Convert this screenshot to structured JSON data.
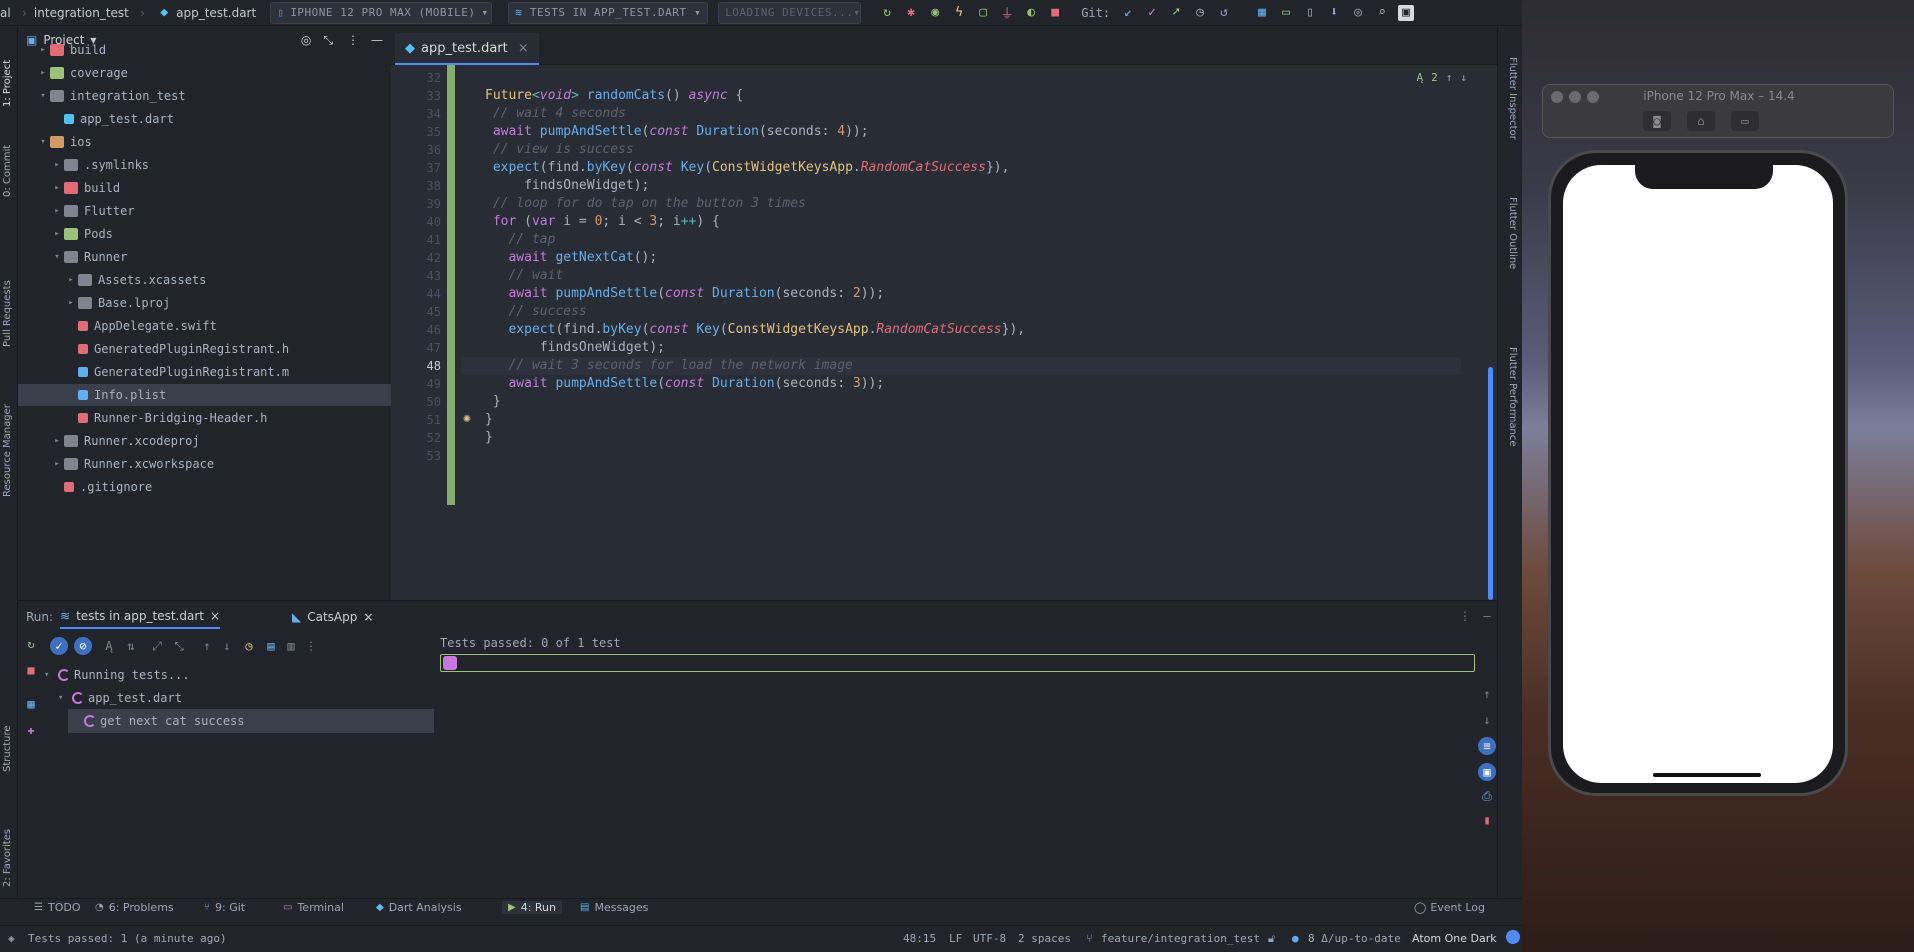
{
  "topbar": {
    "breadcrumb": [
      "al",
      "integration_test",
      "app_test.dart"
    ],
    "device_combo": "IPHONE 12 PRO MAX (MOBILE)",
    "config_combo": "TESTS IN APP_TEST.DART",
    "loading_combo": "LOADING DEVICES...",
    "git_label": "Git:"
  },
  "left_strip": {
    "project_tab": "1: Project",
    "commit_tab": "0: Commit",
    "pull_requests_tab": "Pull Requests",
    "resource_manager_tab": "Resource Manager",
    "structure_tab": "Structure",
    "favorites_tab": "2: Favorites"
  },
  "right_strip": {
    "inspector": "Flutter Inspector",
    "outline": "Flutter Outline",
    "performance": "Flutter Performance"
  },
  "project": {
    "title": "Project",
    "items": [
      {
        "label": "build",
        "indent": 1,
        "arrow": "▸",
        "icon": "folder-red"
      },
      {
        "label": "coverage",
        "indent": 1,
        "arrow": "▸",
        "icon": "folder-green"
      },
      {
        "label": "integration_test",
        "indent": 1,
        "arrow": "▾",
        "icon": "folder"
      },
      {
        "label": "app_test.dart",
        "indent": 2,
        "arrow": "",
        "icon": "dart"
      },
      {
        "label": "ios",
        "indent": 1,
        "arrow": "▾",
        "icon": "tools"
      },
      {
        "label": ".symlinks",
        "indent": 2,
        "arrow": "▸",
        "icon": "folder"
      },
      {
        "label": "build",
        "indent": 2,
        "arrow": "▸",
        "icon": "folder-red"
      },
      {
        "label": "Flutter",
        "indent": 2,
        "arrow": "▸",
        "icon": "folder"
      },
      {
        "label": "Pods",
        "indent": 2,
        "arrow": "▸",
        "icon": "folder-green"
      },
      {
        "label": "Runner",
        "indent": 2,
        "arrow": "▾",
        "icon": "folder"
      },
      {
        "label": "Assets.xcassets",
        "indent": 3,
        "arrow": "▸",
        "icon": "folder"
      },
      {
        "label": "Base.lproj",
        "indent": 3,
        "arrow": "▸",
        "icon": "folder"
      },
      {
        "label": "AppDelegate.swift",
        "indent": 3,
        "arrow": "",
        "icon": "swift"
      },
      {
        "label": "GeneratedPluginRegistrant.h",
        "indent": 3,
        "arrow": "",
        "icon": "h"
      },
      {
        "label": "GeneratedPluginRegistrant.m",
        "indent": 3,
        "arrow": "",
        "icon": "m"
      },
      {
        "label": "Info.plist",
        "indent": 3,
        "arrow": "",
        "icon": "plist",
        "selected": true
      },
      {
        "label": "Runner-Bridging-Header.h",
        "indent": 3,
        "arrow": "",
        "icon": "h"
      },
      {
        "label": "Runner.xcodeproj",
        "indent": 2,
        "arrow": "▸",
        "icon": "folder"
      },
      {
        "label": "Runner.xcworkspace",
        "indent": 2,
        "arrow": "▸",
        "icon": "folder"
      },
      {
        "label": ".gitignore",
        "indent": 2,
        "arrow": "",
        "icon": "git"
      }
    ]
  },
  "editor": {
    "tab_label": "app_test.dart",
    "inspection_count": "2",
    "current_line": 48,
    "lines": [
      {
        "n": 32,
        "t": [
          [
            "",
            ""
          ]
        ]
      },
      {
        "n": 33,
        "t": [
          [
            "ty",
            "Future"
          ],
          [
            "op",
            "<"
          ],
          [
            "kwi",
            "void"
          ],
          [
            "op",
            "> "
          ],
          [
            "fn",
            "randomCats"
          ],
          [
            "",
            "() "
          ],
          [
            "kwi",
            "async"
          ],
          [
            "",
            " {"
          ]
        ]
      },
      {
        "n": 34,
        "t": [
          [
            "",
            " "
          ],
          [
            "cm",
            "// wait 4 seconds"
          ]
        ]
      },
      {
        "n": 35,
        "t": [
          [
            "",
            " "
          ],
          [
            "kw",
            "await "
          ],
          [
            "fn",
            "pumpAndSettle"
          ],
          [
            "",
            "("
          ],
          [
            "kwi",
            "const "
          ],
          [
            "fn",
            "Duration"
          ],
          [
            "",
            "(seconds: "
          ],
          [
            "num",
            "4"
          ],
          [
            "",
            "));"
          ]
        ]
      },
      {
        "n": 36,
        "t": [
          [
            "",
            " "
          ],
          [
            "cm",
            "// view is success"
          ]
        ]
      },
      {
        "n": 37,
        "t": [
          [
            "",
            " "
          ],
          [
            "fn",
            "expect"
          ],
          [
            "",
            "("
          ],
          [
            "",
            "find."
          ],
          [
            "fn",
            "byKey"
          ],
          [
            "",
            "("
          ],
          [
            "kwi",
            "const "
          ],
          [
            "fn",
            "Key"
          ],
          [
            "",
            "("
          ],
          [
            "ty",
            "ConstWidgetKeysApp"
          ],
          [
            "",
            "."
          ],
          [
            "en",
            "RandomCatSuccess"
          ],
          [
            "",
            "}),"
          ]
        ]
      },
      {
        "n": 38,
        "t": [
          [
            "",
            "     findsOneWidget);"
          ]
        ]
      },
      {
        "n": 39,
        "t": [
          [
            "",
            " "
          ],
          [
            "cm",
            "// loop for do tap on the button 3 times"
          ]
        ]
      },
      {
        "n": 40,
        "t": [
          [
            "",
            " "
          ],
          [
            "kw",
            "for "
          ],
          [
            "",
            "("
          ],
          [
            "kw",
            "var"
          ],
          [
            "",
            " i = "
          ],
          [
            "num",
            "0"
          ],
          [
            "",
            "; i < "
          ],
          [
            "num",
            "3"
          ],
          [
            "",
            "; i"
          ],
          [
            "op",
            "++"
          ],
          [
            "",
            ") {"
          ]
        ]
      },
      {
        "n": 41,
        "t": [
          [
            "",
            "   "
          ],
          [
            "cm",
            "// tap"
          ]
        ]
      },
      {
        "n": 42,
        "t": [
          [
            "",
            "   "
          ],
          [
            "kw",
            "await "
          ],
          [
            "fn",
            "getNextCat"
          ],
          [
            "",
            "();"
          ]
        ]
      },
      {
        "n": 43,
        "t": [
          [
            "",
            "   "
          ],
          [
            "cm",
            "// wait"
          ]
        ]
      },
      {
        "n": 44,
        "t": [
          [
            "",
            "   "
          ],
          [
            "kw",
            "await "
          ],
          [
            "fn",
            "pumpAndSettle"
          ],
          [
            "",
            "("
          ],
          [
            "kwi",
            "const "
          ],
          [
            "fn",
            "Duration"
          ],
          [
            "",
            "(seconds: "
          ],
          [
            "num",
            "2"
          ],
          [
            "",
            "));"
          ]
        ]
      },
      {
        "n": 45,
        "t": [
          [
            "",
            "   "
          ],
          [
            "cm",
            "// success"
          ]
        ]
      },
      {
        "n": 46,
        "t": [
          [
            "",
            "   "
          ],
          [
            "fn",
            "expect"
          ],
          [
            "",
            "(find."
          ],
          [
            "fn",
            "byKey"
          ],
          [
            "",
            "("
          ],
          [
            "kwi",
            "const "
          ],
          [
            "fn",
            "Key"
          ],
          [
            "",
            "("
          ],
          [
            "ty",
            "ConstWidgetKeysApp"
          ],
          [
            "",
            "."
          ],
          [
            "en",
            "RandomCatSuccess"
          ],
          [
            "",
            "}),"
          ]
        ]
      },
      {
        "n": 47,
        "t": [
          [
            "",
            "       findsOneWidget);"
          ]
        ]
      },
      {
        "n": 48,
        "t": [
          [
            "",
            "   "
          ],
          [
            "cm",
            "// wait 3 seconds for load the network image"
          ]
        ]
      },
      {
        "n": 49,
        "t": [
          [
            "",
            "   "
          ],
          [
            "kw",
            "await "
          ],
          [
            "fn",
            "pumpAndSettle"
          ],
          [
            "",
            "("
          ],
          [
            "kwi",
            "const "
          ],
          [
            "fn",
            "Duration"
          ],
          [
            "",
            "(seconds: "
          ],
          [
            "num",
            "3"
          ],
          [
            "",
            "));"
          ]
        ]
      },
      {
        "n": 50,
        "t": [
          [
            "",
            " }"
          ]
        ]
      },
      {
        "n": 51,
        "t": [
          [
            "",
            "}"
          ]
        ]
      },
      {
        "n": 52,
        "t": [
          [
            "",
            "}"
          ]
        ]
      },
      {
        "n": 53,
        "t": [
          [
            "",
            ""
          ]
        ]
      }
    ]
  },
  "run": {
    "label": "Run:",
    "tabs": [
      "tests in app_test.dart",
      "CatsApp"
    ],
    "tests_passed": "Tests passed: 0 of 1 test",
    "tree": [
      {
        "label": "Running tests...",
        "indent": 0
      },
      {
        "label": "app_test.dart",
        "indent": 1
      },
      {
        "label": "get next cat success",
        "indent": 2
      }
    ]
  },
  "bottom_tabs": [
    {
      "label": "TODO",
      "icon": "todo-icon"
    },
    {
      "label": "6: Problems",
      "icon": "problems-icon"
    },
    {
      "label": "9: Git",
      "icon": "git-icon"
    },
    {
      "label": "Terminal",
      "icon": "terminal-icon"
    },
    {
      "label": "Dart Analysis",
      "icon": "dart-icon"
    },
    {
      "label": "4: Run",
      "icon": "run-icon"
    },
    {
      "label": "Messages",
      "icon": "messages-icon"
    }
  ],
  "event_log": "Event Log",
  "status": {
    "message": "Tests passed: 1 (a minute ago)",
    "position": "48:15",
    "line_sep": "LF",
    "encoding": "UTF-8",
    "indent": "2 spaces",
    "branch": "feature/integration_test",
    "git_state": "8 Δ/up-to-date",
    "theme": "Atom One Dark"
  },
  "simulator": {
    "title": "iPhone 12 Pro Max – 14.4"
  },
  "colors": {
    "accent": "#528bff",
    "bg": "#21252b",
    "editor_bg": "#282c34",
    "green": "#98c379"
  }
}
